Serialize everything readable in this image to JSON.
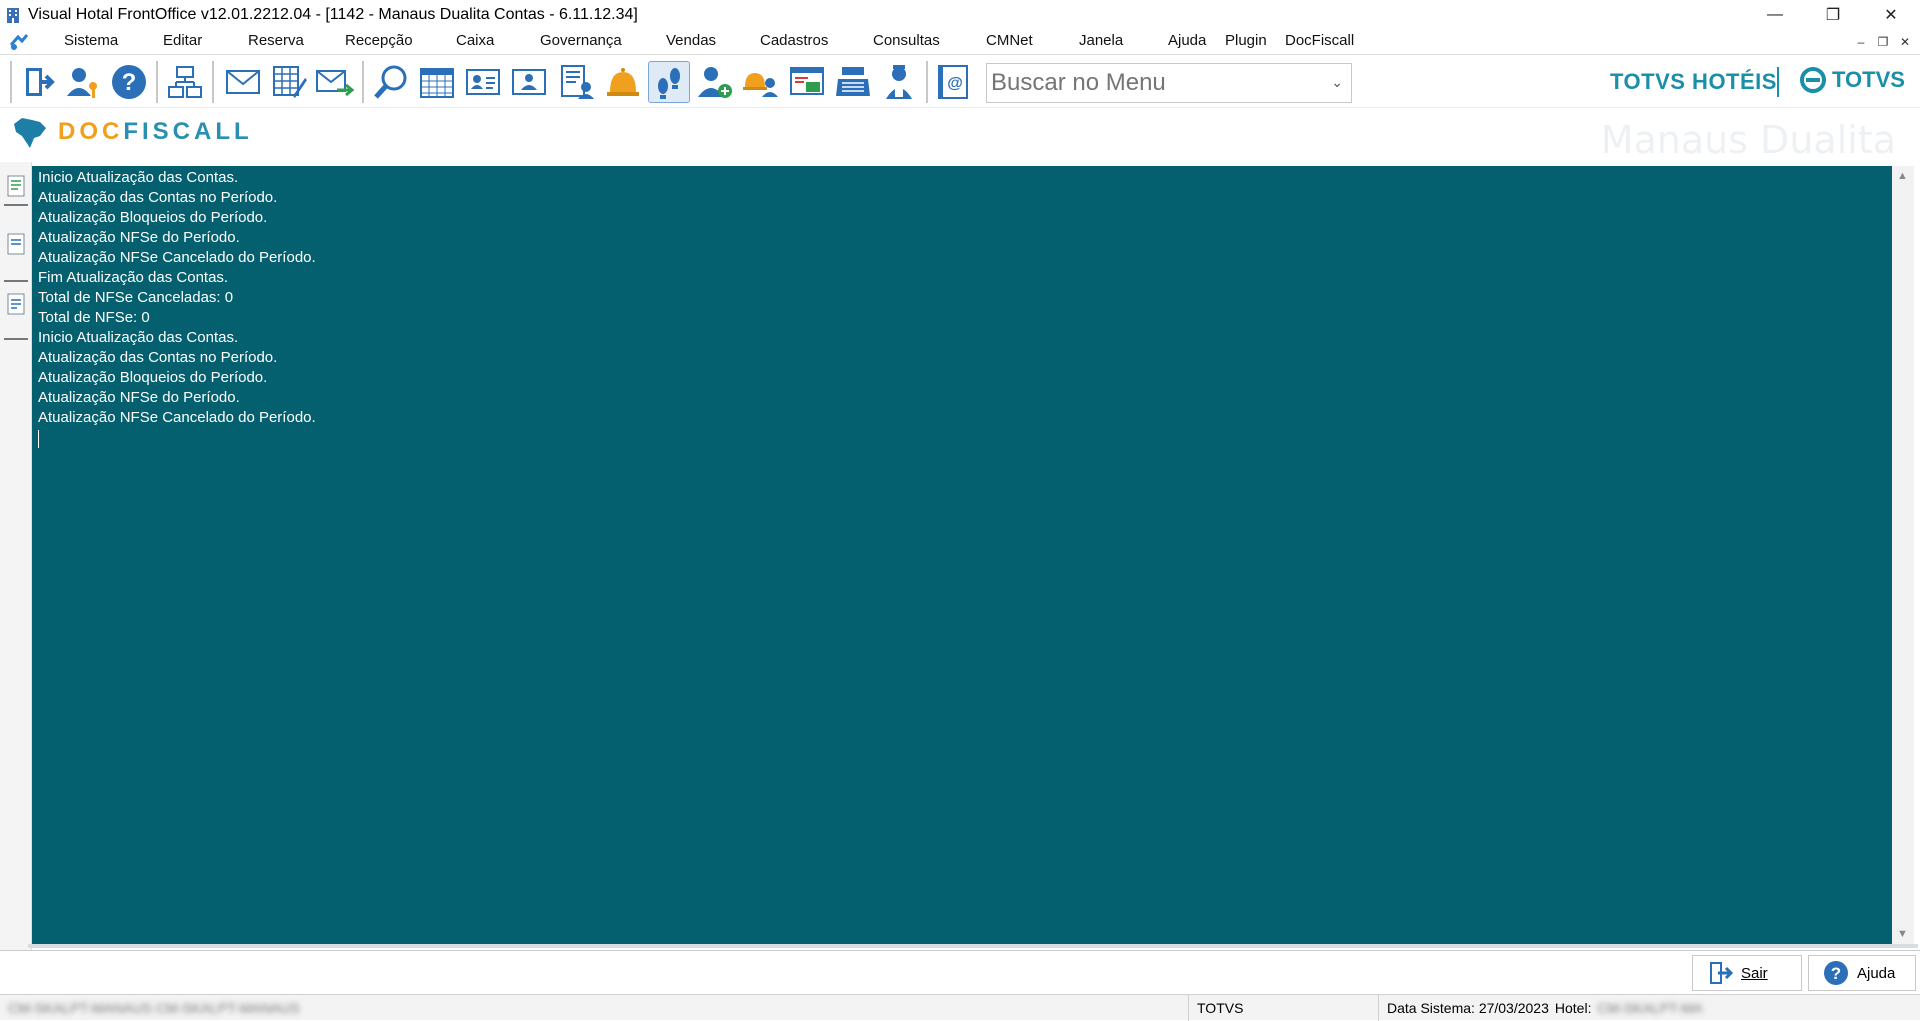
{
  "window": {
    "title": "Visual Hotal FrontOffice v12.01.2212.04 - [1142 - Manaus Dualita Contas - 6.11.12.34]",
    "minimize_label": "—",
    "restore_label": "❐",
    "close_label": "✕"
  },
  "menu": {
    "items": [
      "Sistema",
      "Editar",
      "Reserva",
      "Recepção",
      "Caixa",
      "Governança",
      "Vendas",
      "Cadastros",
      "Consultas",
      "CMNet",
      "Janela",
      "Ajuda",
      "Plugin",
      "DocFiscall"
    ],
    "mdi_minimize": "–",
    "mdi_restore": "❐",
    "mdi_close": "✕"
  },
  "toolbar": {
    "buttons": [
      "exit-icon",
      "user-key-icon",
      "help-icon",
      "sitemap-icon",
      "mail-icon",
      "edit-grid-icon",
      "mail-send-icon",
      "search-icon",
      "calendar-icon",
      "id-card-icon",
      "guest-card-icon",
      "guest-report-icon",
      "bell-icon",
      "footprints-icon",
      "add-guest-icon",
      "bell-guest-icon",
      "cashier-window-icon",
      "cash-register-icon",
      "housekeeper-icon",
      "email-book-icon"
    ],
    "search_placeholder": "Buscar no Menu",
    "brand_hoteis": "TOTVS HOTÉIS",
    "brand_totvs": "TOTVS",
    "colors": {
      "brand": "#1a8fa8",
      "active_bg": "#dfeaf7"
    }
  },
  "header": {
    "doc_brand_part1": "DOC",
    "doc_brand_part2": "FISCALL",
    "hotel_name": "Manaus Dualita"
  },
  "log": {
    "lines": [
      "Inicio Atualização das Contas.",
      "Atualização das Contas no Período.",
      "Atualização Bloqueios do Período.",
      "Atualização NFSe do Período.",
      "Atualização NFSe Cancelado do Período.",
      "Fim Atualização das Contas.",
      "Total de NFSe Canceladas: 0",
      "Total de NFSe: 0",
      "Inicio Atualização das Contas.",
      "Atualização das Contas no Período.",
      "Atualização Bloqueios do Período.",
      "Atualização NFSe do Período.",
      "Atualização NFSe Cancelado do Período."
    ],
    "background": "#045f6e"
  },
  "footer": {
    "exit_label": "Sair",
    "help_label": "Ajuda"
  },
  "status": {
    "left_text": "CM-SKALPT-MANAUS CM-SKALPT-MANAUS",
    "company": "TOTVS",
    "system_date_label": "Data Sistema: 27/03/2023",
    "hotel_label": "Hotel:",
    "hotel_value": "CM-SKALPT-MA"
  }
}
